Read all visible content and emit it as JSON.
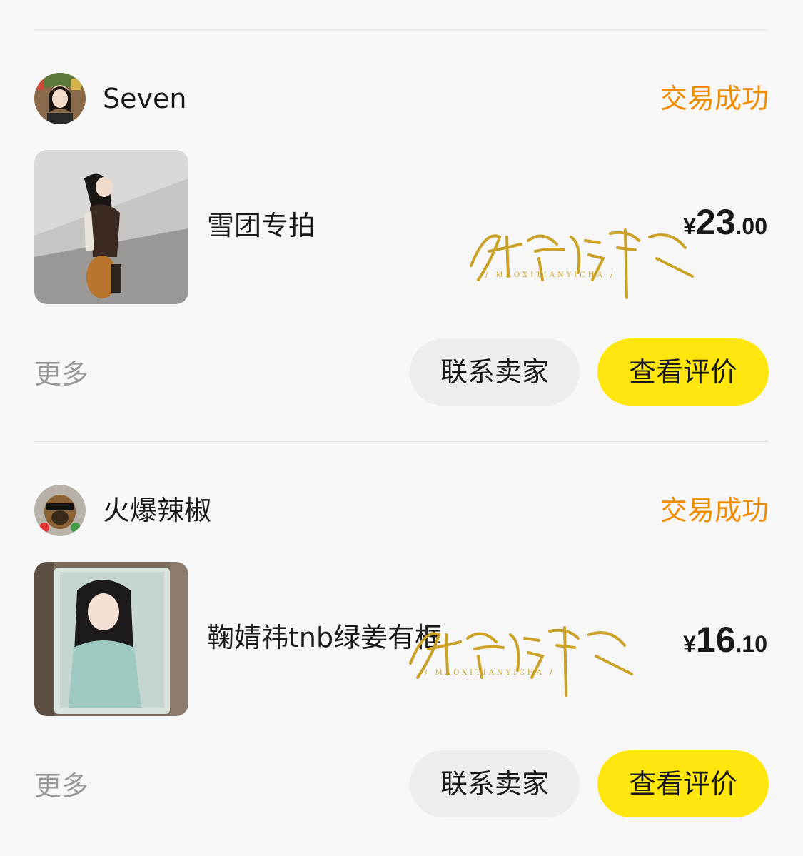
{
  "orders": [
    {
      "seller": "Seven",
      "status": "交易成功",
      "item_title": "雪团专拍",
      "price_symbol": "¥",
      "price_int": "23",
      "price_dec": ".00",
      "more_label": "更多",
      "contact_label": "联系卖家",
      "review_label": "查看评价"
    },
    {
      "seller": "火爆辣椒",
      "status": "交易成功",
      "item_title": "鞠婧祎tnb绿姜有框",
      "price_symbol": "¥",
      "price_int": "16",
      "price_dec": ".10",
      "more_label": "更多",
      "contact_label": "联系卖家",
      "review_label": "查看评价"
    }
  ],
  "colors": {
    "background": "#f7f7f7",
    "status": "#f08c00",
    "review_button": "#ffe60f",
    "contact_button": "#ededed",
    "more_text": "#999999",
    "watermark_gold": "#c9a227"
  },
  "icons": {
    "watermark": "gold-calligraphy-watermark"
  }
}
